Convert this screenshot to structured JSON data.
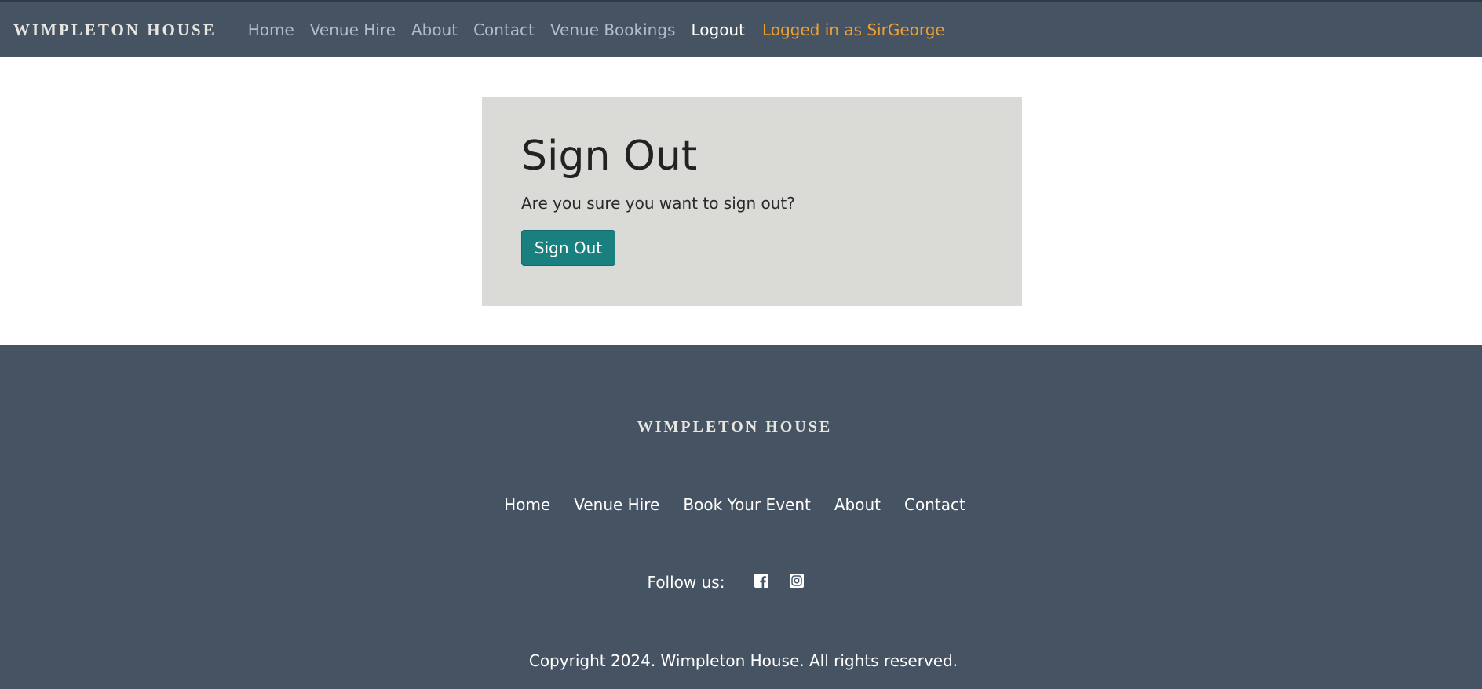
{
  "navbar": {
    "brand": "WIMPLETON HOUSE",
    "links": [
      {
        "label": "Home"
      },
      {
        "label": "Venue Hire"
      },
      {
        "label": "About"
      },
      {
        "label": "Contact"
      },
      {
        "label": "Venue Bookings"
      },
      {
        "label": "Logout"
      }
    ],
    "user_status": "Logged in as SirGeorge"
  },
  "signout_card": {
    "title": "Sign Out",
    "prompt": "Are you sure you want to sign out?",
    "button_label": "Sign Out"
  },
  "footer": {
    "brand": "WIMPLETON HOUSE",
    "links": [
      {
        "label": "Home"
      },
      {
        "label": "Venue Hire"
      },
      {
        "label": "Book Your Event"
      },
      {
        "label": "About"
      },
      {
        "label": "Contact"
      }
    ],
    "follow_label": "Follow us:",
    "social_icons": [
      "facebook-icon",
      "instagram-icon"
    ],
    "copyright": "Copyright 2024. Wimpleton House. All rights reserved."
  },
  "colors": {
    "nav_bg": "#465363",
    "accent_user": "#f0a030",
    "button_bg": "#1a7f7f",
    "card_bg": "#dadbd6"
  }
}
